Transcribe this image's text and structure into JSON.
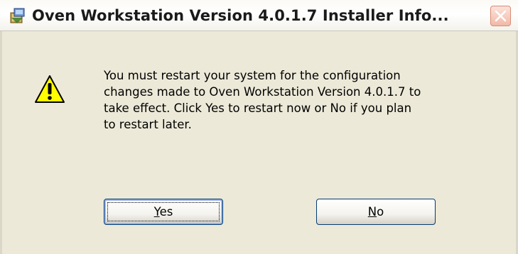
{
  "window": {
    "title": "Oven Workstation Version 4.0.1.7 Installer Info...",
    "app_icon": "installer-icon",
    "close_icon": "close-icon"
  },
  "dialog": {
    "icon": "warning-icon",
    "message_lines": [
      "You must restart your system for the configuration",
      "changes made to Oven Workstation Version 4.0.1.7 to",
      "take effect. Click Yes to restart now or No if you plan",
      "to restart later."
    ]
  },
  "buttons": {
    "yes": {
      "accel": "Y",
      "rest": "es"
    },
    "no": {
      "accel": "N",
      "rest": "o"
    }
  },
  "colors": {
    "dialog_background": "#ece9d8",
    "button_border": "#003c74",
    "close_button": "#f2b9a8",
    "warning_fill": "#ffff00"
  }
}
